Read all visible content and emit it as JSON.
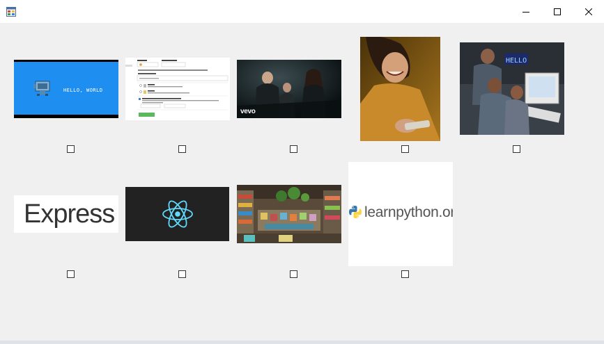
{
  "window": {
    "title": "",
    "app_icon": "form-icon",
    "controls": [
      "minimize-icon",
      "maximize-icon",
      "close-icon"
    ]
  },
  "tiles": [
    {
      "name": "hello-world-tile",
      "image": "pixel-art-robot-hello-world",
      "text": "HELLO, WORLD",
      "checked": false
    },
    {
      "name": "form-screenshot-tile",
      "image": "repository-form-screenshot",
      "checked": false
    },
    {
      "name": "music-video-tile",
      "image": "music-video-still",
      "text": "vevo",
      "checked": false
    },
    {
      "name": "person-laughing-tile",
      "image": "person-laughing-photo",
      "checked": false
    },
    {
      "name": "programmers-tile",
      "image": "programmers-at-computer-photo",
      "checked": false
    },
    {
      "name": "express-tile",
      "image": "express-logo",
      "text": "Express",
      "checked": false
    },
    {
      "name": "react-tile",
      "image": "react-logo",
      "checked": false
    },
    {
      "name": "shop-tile",
      "image": "shop-interior-photo",
      "checked": false
    },
    {
      "name": "learnpython-tile",
      "image": "learnpython-logo",
      "text": "learnpython.org",
      "checked": false
    }
  ],
  "colors": {
    "hello_bg": "#1e8ff0",
    "react_bg": "#222222",
    "react_blue": "#61dafb",
    "python_blue": "#3776ab",
    "python_yellow": "#ffd43b"
  }
}
